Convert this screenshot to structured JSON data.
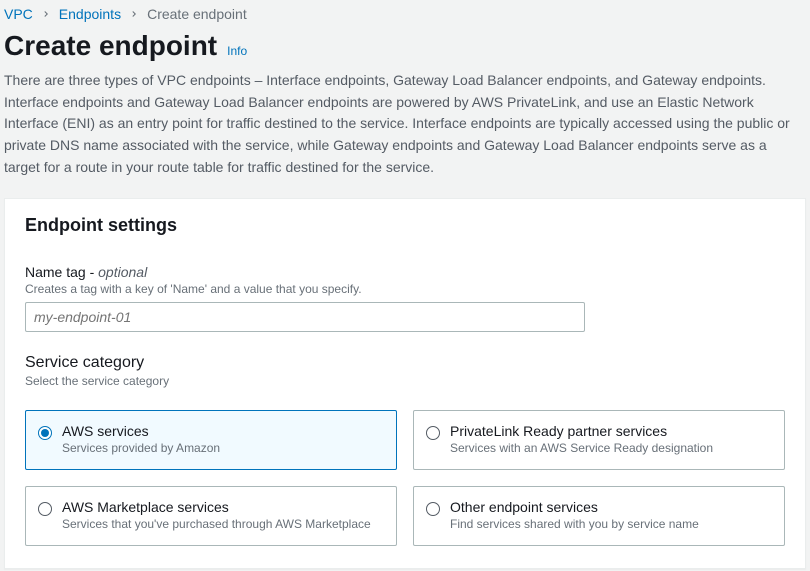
{
  "breadcrumb": {
    "item0": "VPC",
    "item1": "Endpoints",
    "item2": "Create endpoint"
  },
  "page": {
    "title": "Create endpoint",
    "info_label": "Info",
    "description": "There are three types of VPC endpoints – Interface endpoints, Gateway Load Balancer endpoints, and Gateway endpoints. Interface endpoints and Gateway Load Balancer endpoints are powered by AWS PrivateLink, and use an Elastic Network Interface (ENI) as an entry point for traffic destined to the service. Interface endpoints are typically accessed using the public or private DNS name associated with the service, while Gateway endpoints and Gateway Load Balancer endpoints serve as a target for a route in your route table for traffic destined for the service."
  },
  "panel": {
    "title": "Endpoint settings",
    "name_tag": {
      "label": "Name tag - ",
      "optional": "optional",
      "help": "Creates a tag with a key of 'Name' and a value that you specify.",
      "placeholder": "my-endpoint-01"
    },
    "service_category": {
      "label": "Service category",
      "help": "Select the service category",
      "options": [
        {
          "title": "AWS services",
          "desc": "Services provided by Amazon",
          "selected": true
        },
        {
          "title": "PrivateLink Ready partner services",
          "desc": "Services with an AWS Service Ready designation",
          "selected": false
        },
        {
          "title": "AWS Marketplace services",
          "desc": "Services that you've purchased through AWS Marketplace",
          "selected": false
        },
        {
          "title": "Other endpoint services",
          "desc": "Find services shared with you by service name",
          "selected": false
        }
      ]
    }
  }
}
